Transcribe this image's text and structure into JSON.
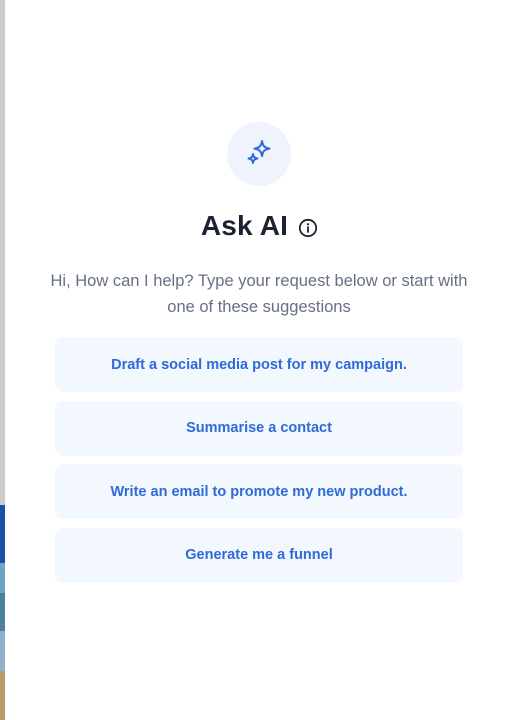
{
  "header": {
    "icon": "sparkle-icon",
    "title": "Ask AI",
    "info_icon": "info-icon"
  },
  "intro": {
    "text": "Hi, How can I help? Type your request below or start with one of these suggestions"
  },
  "suggestions": [
    {
      "label": "Draft a social media post for my campaign."
    },
    {
      "label": "Summarise a contact"
    },
    {
      "label": "Write an email to promote my new product."
    },
    {
      "label": "Generate me a funnel"
    }
  ],
  "colors": {
    "accent": "#2f6bd6",
    "suggestion_bg": "#f3f7fe",
    "icon_circle_bg": "#eef3fd",
    "title": "#1b2230",
    "muted_text": "#667085"
  }
}
